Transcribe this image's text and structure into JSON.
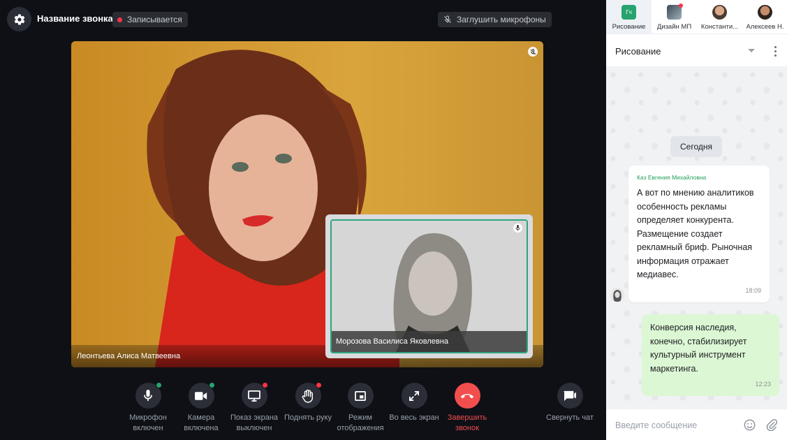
{
  "call": {
    "title": "Название звонка",
    "recording": "Записывается",
    "mute_all": "Заглушить микрофоны",
    "main_participant": "Леонтьева Алиса Матвеевна",
    "pip_participant": "Морозова Василиса Яковлевна"
  },
  "controls": [
    {
      "label": "Микрофон включен",
      "icon": "microphone-icon",
      "status_color": "#27a36f"
    },
    {
      "label": "Камера включена",
      "icon": "camera-icon",
      "status_color": "#27a36f"
    },
    {
      "label": "Показ экрана выключен",
      "icon": "screen-share-icon",
      "status_color": "#ff3347"
    },
    {
      "label": "Поднять руку",
      "icon": "raise-hand-icon",
      "status_color": "#ff3347"
    },
    {
      "label": "Режим отображения",
      "icon": "picture-in-picture-icon"
    },
    {
      "label": "Во весь экран",
      "icon": "fullscreen-icon"
    },
    {
      "label": "Завершить звонок",
      "icon": "hang-up-icon",
      "color": "#f24e4e"
    },
    {
      "label": "Свернуть чат",
      "icon": "chat-collapse-icon"
    }
  ],
  "chat": {
    "tabs": [
      {
        "label": "Рисование",
        "badge": "Гч",
        "color": "#27a36f"
      },
      {
        "label": "Дизайн МП"
      },
      {
        "label": "Константи..."
      },
      {
        "label": "Алексеев Н."
      }
    ],
    "title": "Рисование",
    "date_separator": "Сегодня",
    "incoming": {
      "author": "Каз Евгения Михайловна",
      "text": "А вот по мнению аналитиков особенность рекламы определяет конкурента. Размещение создает рекламный бриф. Рыночная информация отражает медиавес.",
      "time": "18:09"
    },
    "outgoing": {
      "text": "Конверсия наследия, конечно, стабилизирует культурный инструмент маркетинга.",
      "time": "12:23"
    },
    "composer_placeholder": "Введите сообщение"
  }
}
